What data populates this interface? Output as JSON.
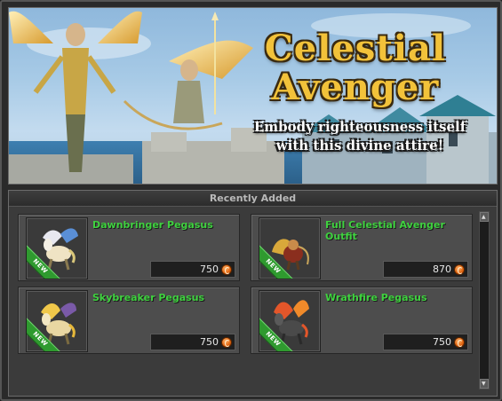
{
  "banner": {
    "title_line1": "Celestial",
    "title_line2": "Avenger",
    "subtitle_line1": "Embody righteousness itself",
    "subtitle_line2": "with this divine attire!"
  },
  "recent": {
    "header": "Recently Added",
    "badge": "NEW",
    "items": [
      {
        "name": "Dawnbringer Pegasus",
        "price": "750",
        "icon": "white-pegasus-icon"
      },
      {
        "name": "Full Celestial Avenger Outfit",
        "price": "870",
        "icon": "outfit-icon"
      },
      {
        "name": "Skybreaker Pegasus",
        "price": "750",
        "icon": "gold-pegasus-icon"
      },
      {
        "name": "Wrathfire Pegasus",
        "price": "750",
        "icon": "fire-pegasus-icon"
      }
    ]
  },
  "colors": {
    "item_name": "#3fd13f",
    "title_gold": "#f2c23a",
    "coin_orange": "#e0640f",
    "new_green": "#2f9a2f"
  }
}
